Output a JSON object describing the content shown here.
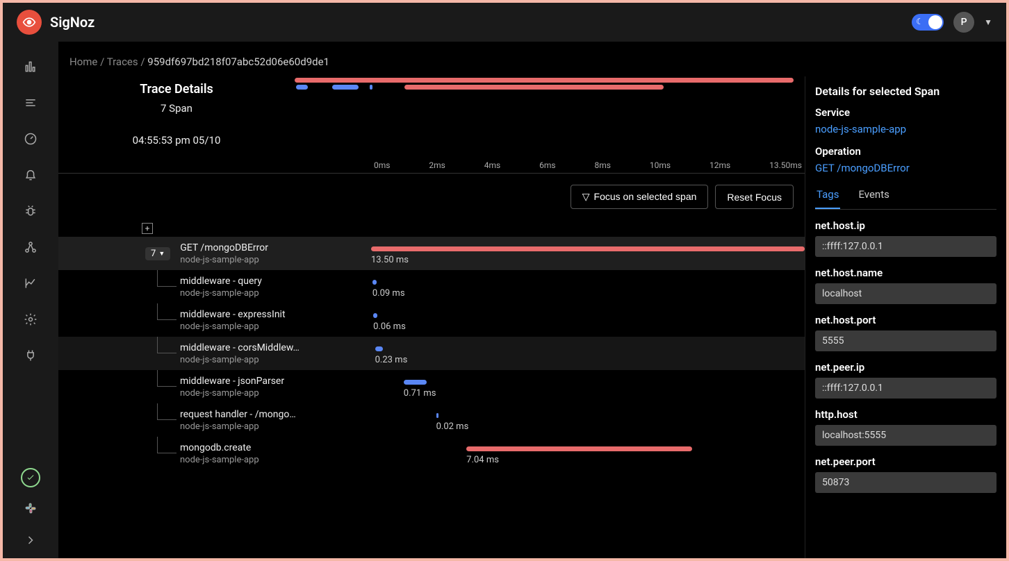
{
  "brand": "SigNoz",
  "user_initial": "P",
  "breadcrumb": {
    "home": "Home",
    "section": "Traces",
    "trace_id": "959df697bd218f07abc52d06e60d9de1"
  },
  "trace": {
    "title": "Trace Details",
    "span_count": "7 Span",
    "timestamp": "04:55:53 pm 05/10"
  },
  "axis": [
    "0ms",
    "2ms",
    "4ms",
    "6ms",
    "8ms",
    "10ms",
    "12ms",
    "13.50ms"
  ],
  "buttons": {
    "focus": "Focus on selected span",
    "reset": "Reset Focus"
  },
  "root_count": "7",
  "spans": [
    {
      "name": "GET /mongoDBError",
      "service": "node-js-sample-app",
      "duration": "13.50 ms",
      "start_pct": 0,
      "width_pct": 100,
      "color": "#e86b6b",
      "child": false,
      "selected": true
    },
    {
      "name": "middleware - query",
      "service": "node-js-sample-app",
      "duration": "0.09 ms",
      "start_pct": 0.3,
      "width_pct": 1,
      "color": "#5a87f5",
      "child": true
    },
    {
      "name": "middleware - expressInit",
      "service": "node-js-sample-app",
      "duration": "0.06 ms",
      "start_pct": 0.5,
      "width_pct": 1,
      "color": "#5a87f5",
      "child": true
    },
    {
      "name": "middleware - corsMiddlew…",
      "service": "node-js-sample-app",
      "duration": "0.23 ms",
      "start_pct": 0.9,
      "width_pct": 1.8,
      "color": "#5a87f5",
      "child": true,
      "highlighted": true
    },
    {
      "name": "middleware - jsonParser",
      "service": "node-js-sample-app",
      "duration": "0.71 ms",
      "start_pct": 7.5,
      "width_pct": 5.3,
      "color": "#5a87f5",
      "child": true
    },
    {
      "name": "request handler - /mongo…",
      "service": "node-js-sample-app",
      "duration": "0.02 ms",
      "start_pct": 15,
      "width_pct": 0.5,
      "color": "#5a87f5",
      "child": true
    },
    {
      "name": "mongodb.create",
      "service": "node-js-sample-app",
      "duration": "7.04 ms",
      "start_pct": 22,
      "width_pct": 52,
      "color": "#e86b6b",
      "child": true
    }
  ],
  "details": {
    "heading": "Details for selected Span",
    "service_label": "Service",
    "service": "node-js-sample-app",
    "operation_label": "Operation",
    "operation": "GET /mongoDBError",
    "tabs": {
      "tags": "Tags",
      "events": "Events"
    },
    "tags": [
      {
        "key": "net.host.ip",
        "value": "::ffff:127.0.0.1"
      },
      {
        "key": "net.host.name",
        "value": "localhost"
      },
      {
        "key": "net.host.port",
        "value": "5555"
      },
      {
        "key": "net.peer.ip",
        "value": "::ffff:127.0.0.1"
      },
      {
        "key": "http.host",
        "value": "localhost:5555"
      },
      {
        "key": "net.peer.port",
        "value": "50873"
      }
    ]
  },
  "chart_data": {
    "type": "gantt",
    "title": "Trace Details",
    "x_unit": "ms",
    "xlim": [
      0,
      13.5
    ],
    "series": [
      {
        "name": "GET /mongoDBError",
        "start": 0,
        "duration": 13.5,
        "status": "error"
      },
      {
        "name": "middleware - query",
        "start": 0.04,
        "duration": 0.09,
        "status": "ok"
      },
      {
        "name": "middleware - expressInit",
        "start": 0.07,
        "duration": 0.06,
        "status": "ok"
      },
      {
        "name": "middleware - corsMiddleware",
        "start": 0.12,
        "duration": 0.23,
        "status": "ok"
      },
      {
        "name": "middleware - jsonParser",
        "start": 1.0,
        "duration": 0.71,
        "status": "ok"
      },
      {
        "name": "request handler - /mongoDBError",
        "start": 2.0,
        "duration": 0.02,
        "status": "ok"
      },
      {
        "name": "mongodb.create",
        "start": 3.0,
        "duration": 7.04,
        "status": "error"
      }
    ]
  }
}
